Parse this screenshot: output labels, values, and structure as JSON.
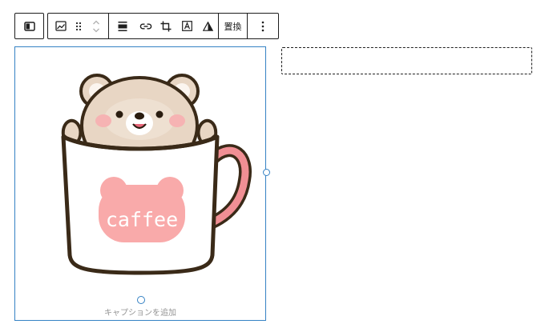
{
  "toolbar": {
    "parent_block_icon": "block-parent-icon",
    "image_type_icon": "image-icon",
    "drag_icon": "drag-handle-icon",
    "move_icon": "chevron-up-down-icon",
    "align_icon": "align-center-icon",
    "link_icon": "link-icon",
    "crop_icon": "crop-icon",
    "text_overlay_icon": "text-over-image-icon",
    "duotone_icon": "duotone-icon",
    "replace_label": "置換",
    "more_icon": "more-vertical-icon"
  },
  "image_block": {
    "image_text": "caffee",
    "caption_placeholder": "キャプションを追加",
    "accent_color": "#3582c4"
  },
  "colors": {
    "mug_outline": "#3a2a18",
    "bear_fur": "#e8d6c4",
    "blush": "#f6b3b3",
    "logo_pink": "#f9aaaa",
    "handle_pink": "#f08f94"
  }
}
